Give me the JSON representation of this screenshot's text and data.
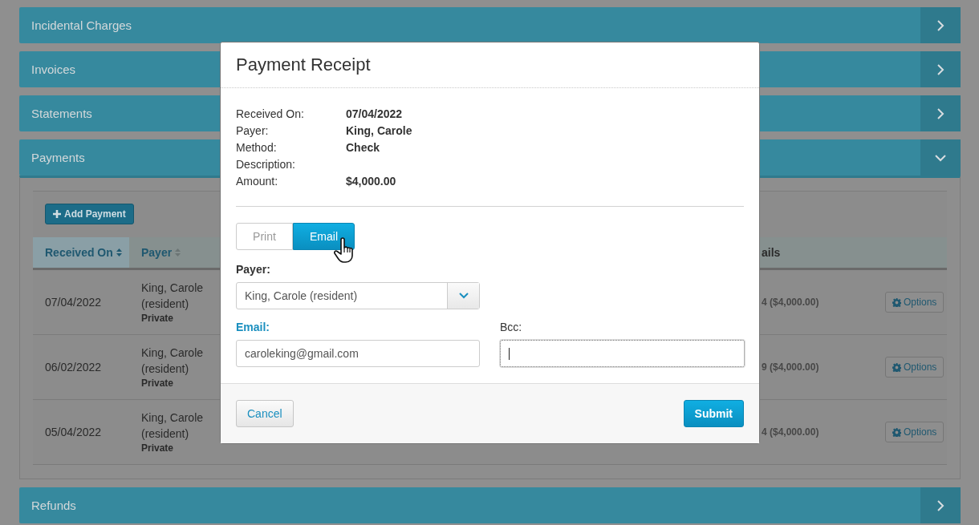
{
  "panels": [
    {
      "title": "Incidental Charges",
      "expanded": false
    },
    {
      "title": "Invoices",
      "expanded": false
    },
    {
      "title": "Statements",
      "expanded": false
    },
    {
      "title": "Payments",
      "expanded": true,
      "add_button": "Add Payment",
      "table": {
        "columns": [
          {
            "label": "Received On",
            "sortable": true,
            "sorted": true
          },
          {
            "label": "Payer",
            "sortable": true,
            "sorted": false
          },
          {
            "label": "ails",
            "sortable": false,
            "sorted": false
          }
        ],
        "rows": [
          {
            "received_on": "07/04/2022",
            "payer_name": "King, Carole",
            "payer_role": "(resident)",
            "payer_type": "Private",
            "details": "4 ($4,000.00)",
            "button": "Options"
          },
          {
            "received_on": "06/02/2022",
            "payer_name": "King, Carole",
            "payer_role": "(resident)",
            "payer_type": "Private",
            "details": "9 ($4,000.00)",
            "button": "Options"
          },
          {
            "received_on": "05/04/2022",
            "payer_name": "King, Carole",
            "payer_role": "(resident)",
            "payer_type": "Private",
            "details": "4 ($4,000.00)",
            "button": "Options"
          }
        ]
      }
    },
    {
      "title": "Refunds",
      "expanded": false
    }
  ],
  "modal": {
    "title": "Payment Receipt",
    "details": [
      {
        "label": "Received On:",
        "value": "07/04/2022"
      },
      {
        "label": "Payer:",
        "value": "King, Carole"
      },
      {
        "label": "Method:",
        "value": "Check"
      },
      {
        "label": "Description:"
      },
      {
        "label": "Amount:",
        "value": "$4,000.00"
      }
    ],
    "toggle": [
      {
        "label": "Print",
        "selected": false
      },
      {
        "label": "Email",
        "selected": true
      }
    ],
    "payer_label": "Payer:",
    "payer_select": "King, Carole (resident)",
    "email_label": "Email:",
    "email_value": "caroleking@gmail.com",
    "bcc_label": "Bcc:",
    "bcc_focused": true,
    "cancel": "Cancel",
    "submit": "Submit"
  }
}
